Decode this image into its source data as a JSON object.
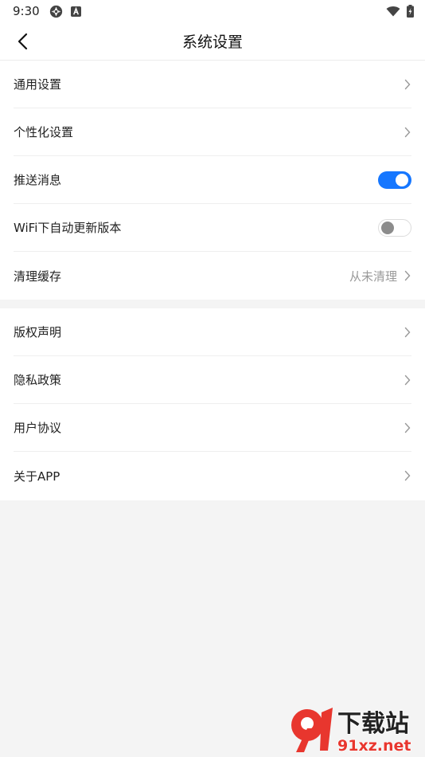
{
  "status_bar": {
    "time": "9:30",
    "icons_left": [
      "android-system-icon",
      "app-a-icon"
    ],
    "icons_right": [
      "wifi-icon",
      "battery-icon"
    ]
  },
  "header": {
    "title": "系统设置",
    "back_icon": "back-arrow-icon"
  },
  "group1": {
    "items": [
      {
        "label": "通用设置",
        "type": "link"
      },
      {
        "label": "个性化设置",
        "type": "link"
      },
      {
        "label": "推送消息",
        "type": "toggle",
        "on": true
      },
      {
        "label": "WiFi下自动更新版本",
        "type": "toggle",
        "on": false
      },
      {
        "label": "清理缓存",
        "type": "link",
        "value": "从未清理"
      }
    ]
  },
  "group2": {
    "items": [
      {
        "label": "版权声明",
        "type": "link"
      },
      {
        "label": "隐私政策",
        "type": "link"
      },
      {
        "label": "用户协议",
        "type": "link"
      },
      {
        "label": "关于APP",
        "type": "link"
      }
    ]
  },
  "watermark": {
    "cn": "下载站",
    "domain": "91xz.net"
  },
  "colors": {
    "accent": "#1677ff",
    "background": "#f4f4f4",
    "surface": "#ffffff",
    "muted_text": "#999999",
    "watermark_red": "#e8362e"
  }
}
